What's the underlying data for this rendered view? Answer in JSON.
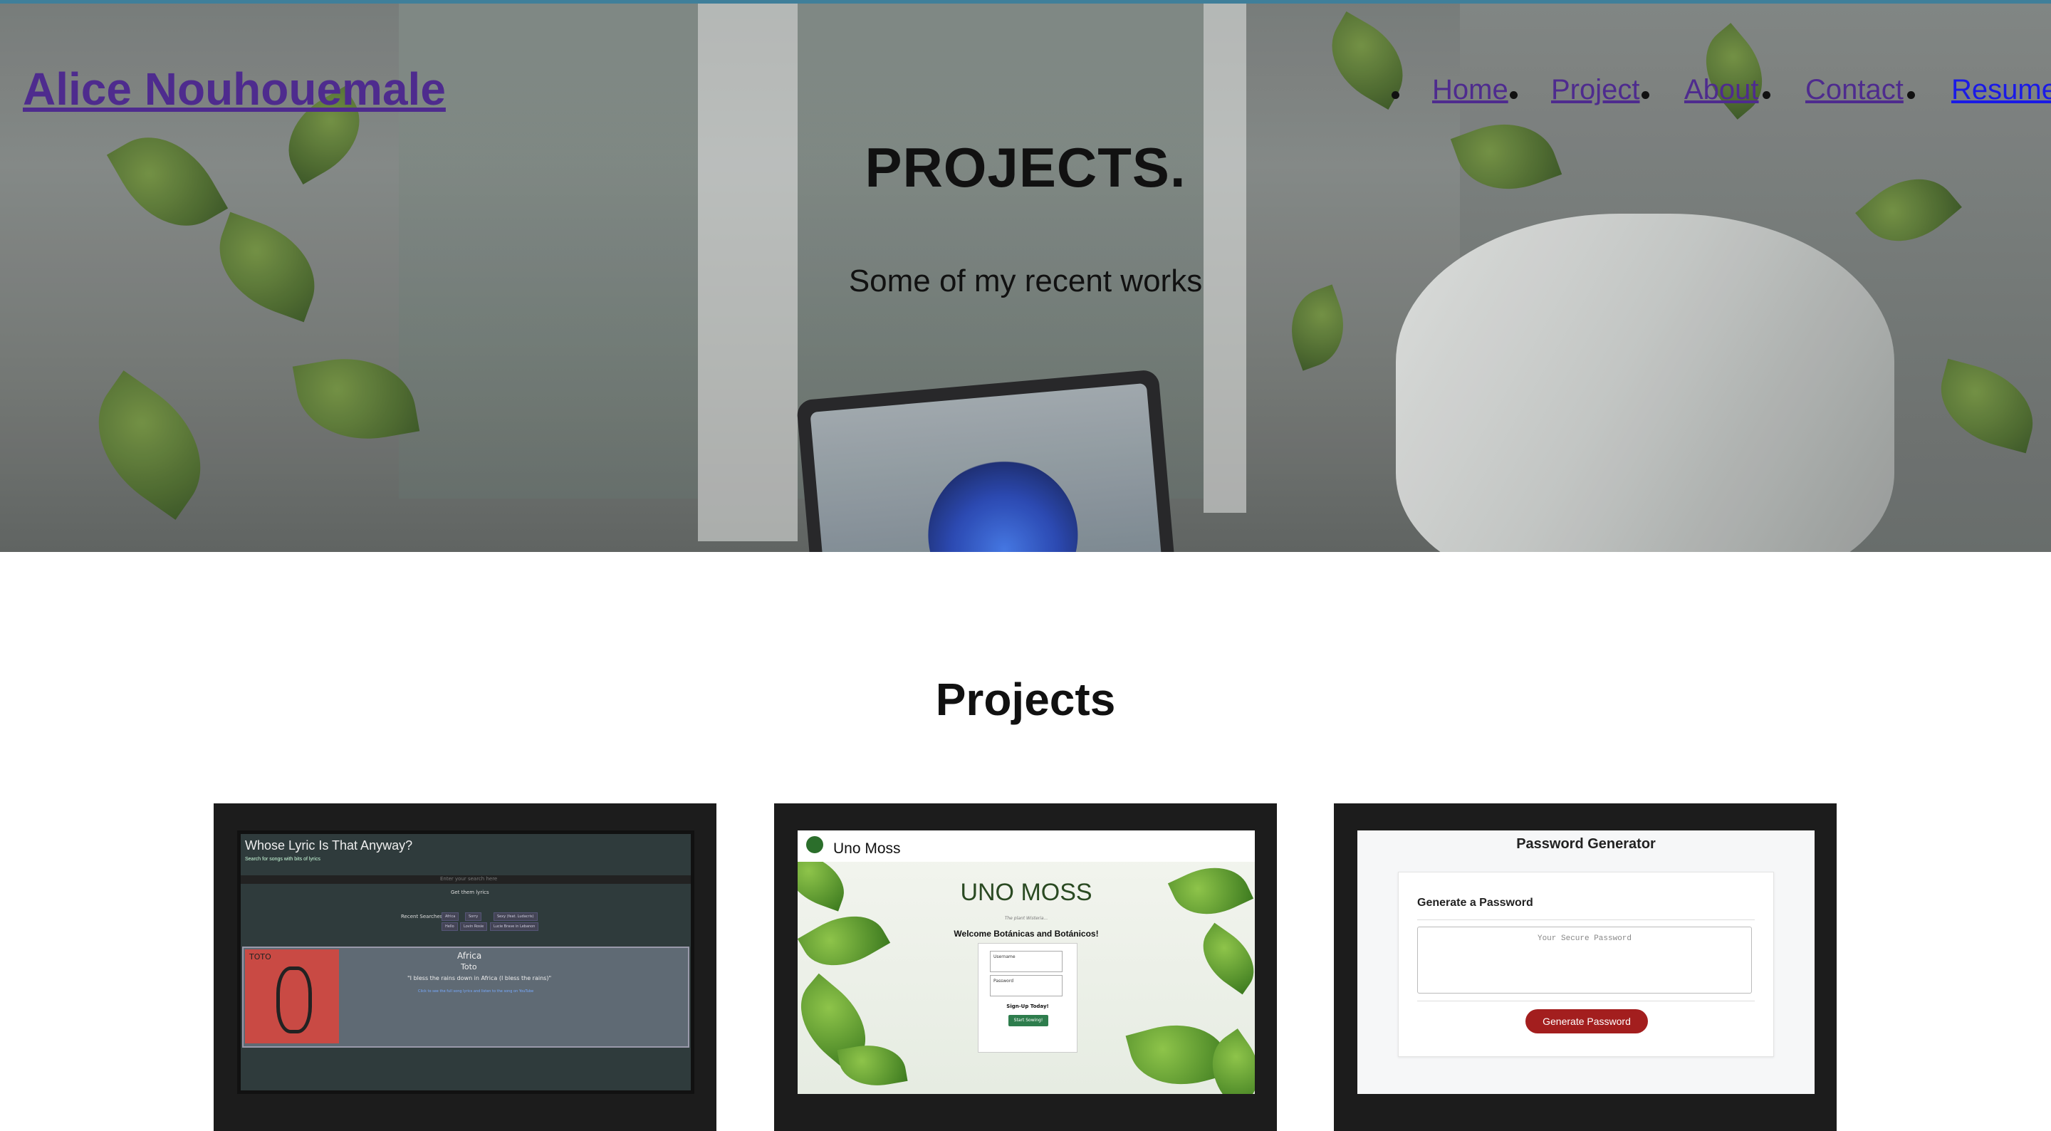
{
  "site": {
    "title": "Alice Nouhouemale",
    "nav": [
      "Home",
      "Project",
      "About",
      "Contact",
      "Resume"
    ]
  },
  "hero": {
    "heading": "PROJECTS.",
    "subtitle": "Some of my recent works"
  },
  "projects": {
    "heading": "Projects",
    "cards": [
      {
        "title": "Whose Lyric Is That Anyway?",
        "subtitle": "Search for songs with bits of lyrics",
        "input_placeholder": "Enter your search here",
        "button": "Get them lyrics",
        "recent_label": "Recent Searches:",
        "chips": [
          "Africa",
          "Sorry",
          "Sexy (feat. Ludacris)",
          "Hello",
          "Lovin Rosie",
          "Lucie Brave in Lebanon"
        ],
        "song": "Africa",
        "artist": "Toto",
        "quote": "\"I bless the rains down in Africa (I bless the rains)\"",
        "link": "Click to see the full song lyrics and listen to the song on YouTube",
        "album_text": "TOTO"
      },
      {
        "brand": "Uno Moss",
        "heading": "UNO MOSS",
        "tagline": "The plant Wisteria...",
        "welcome": "Welcome Botánicas and Botánicos!",
        "username_label": "Username",
        "password_label": "Password",
        "signup": "Sign-Up Today!",
        "start": "Start Sowing!"
      },
      {
        "title": "Password Generator",
        "panel_heading": "Generate a Password",
        "placeholder": "Your Secure Password",
        "button": "Generate Password"
      }
    ]
  },
  "colors": {
    "link_visited": "#4e2b8e",
    "link_unvisited": "#1a1ae6",
    "card_bg": "#1c1c1c",
    "generate_button": "#a31e1e",
    "start_button": "#2e7d4d"
  }
}
